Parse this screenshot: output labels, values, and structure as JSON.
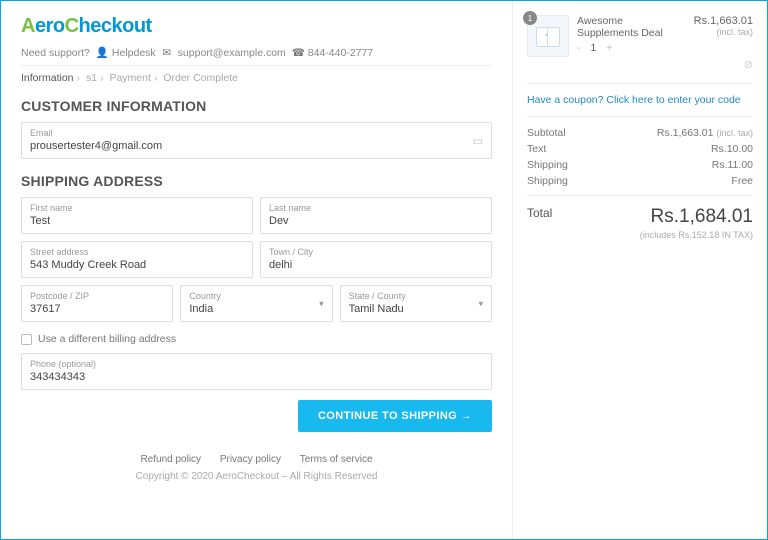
{
  "brand": {
    "part1": "A",
    "part2": "ero",
    "part3": "C",
    "part4": "heckout"
  },
  "support": {
    "label": "Need support?",
    "helpdesk": "Helpdesk",
    "email": "support@example.com",
    "phone": "844-440-2777"
  },
  "breadcrumbs": {
    "step1": "Information",
    "step2": "s1",
    "step3": "Payment",
    "step4": "Order Complete"
  },
  "sections": {
    "customer": "CUSTOMER INFORMATION",
    "shipping": "SHIPPING ADDRESS"
  },
  "fields": {
    "email": {
      "label": "Email",
      "value": "prousertester4@gmail.com"
    },
    "first": {
      "label": "First name",
      "value": "Test"
    },
    "last": {
      "label": "Last name",
      "value": "Dev"
    },
    "street": {
      "label": "Street address",
      "value": "543 Muddy Creek Road"
    },
    "city": {
      "label": "Town / City",
      "value": "delhi"
    },
    "zip": {
      "label": "Postcode / ZIP",
      "value": "37617"
    },
    "country": {
      "label": "Country",
      "value": "India"
    },
    "state": {
      "label": "State / County",
      "value": "Tamil Nadu"
    },
    "phone": {
      "label": "Phone (optional)",
      "value": "343434343"
    }
  },
  "checkbox": {
    "label": "Use a different billing address"
  },
  "cta": "CONTINUE TO SHIPPING →",
  "footer": {
    "links": {
      "refund": "Refund policy",
      "privacy": "Privacy policy",
      "terms": "Terms of service"
    },
    "copy": "Copyright © 2020 AeroCheckout – All Rights Reserved"
  },
  "order": {
    "item": {
      "qty_badge": "1",
      "name": "Awesome Supplements Deal",
      "price": "Rs.1,663.01",
      "tax": "(incl. tax)",
      "qty": "1"
    },
    "coupon": "Have a coupon? Click here to enter your code",
    "lines": {
      "subtotal": {
        "l": "Subtotal",
        "r": "Rs.1,663.01",
        "note": "(incl. tax)"
      },
      "text": {
        "l": "Text",
        "r": "Rs.10.00"
      },
      "ship1": {
        "l": "Shipping",
        "r": "Rs.11.00"
      },
      "ship2": {
        "l": "Shipping",
        "r": "Free"
      }
    },
    "total": {
      "l": "Total",
      "amt": "Rs.1,684.01",
      "inc": "(includes Rs.152.18 IN TAX)"
    }
  }
}
